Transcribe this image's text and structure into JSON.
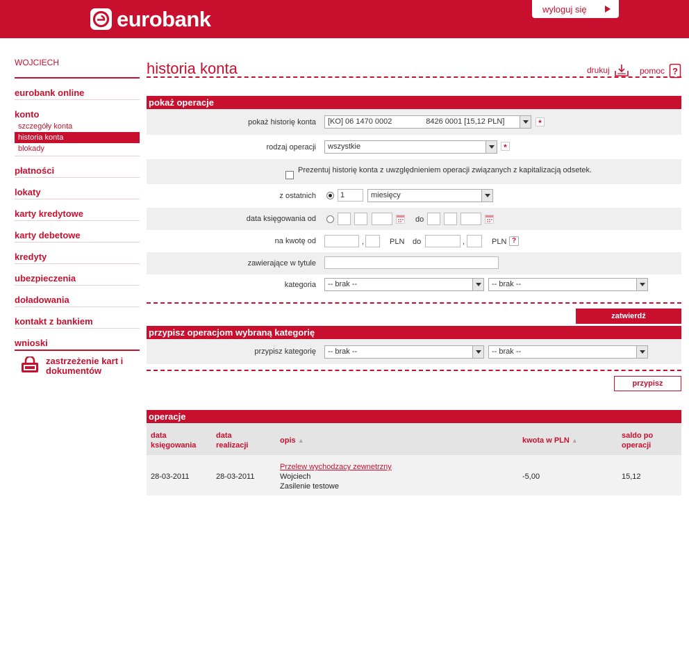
{
  "header": {
    "brand": "eurobank",
    "logout_label": "wyloguj się"
  },
  "sidebar": {
    "user": "WOJCIECH",
    "items": [
      {
        "label": "eurobank online"
      },
      {
        "label": "konto",
        "sub": [
          "szczegóły konta",
          "historia konta",
          "blokady"
        ],
        "active_sub": "historia konta"
      },
      {
        "label": "płatności"
      },
      {
        "label": "lokaty"
      },
      {
        "label": "karty kredytowe"
      },
      {
        "label": "karty debetowe"
      },
      {
        "label": "kredyty"
      },
      {
        "label": "ubezpieczenia"
      },
      {
        "label": "doładowania"
      },
      {
        "label": "kontakt z bankiem"
      },
      {
        "label": "wnioski"
      }
    ],
    "lock_line1": "zastrzeżenie kart i",
    "lock_line2": "dokumentów"
  },
  "page": {
    "title": "historia konta",
    "print_label": "drukuj",
    "help_label": "pomoc"
  },
  "filter": {
    "section_title": "pokaż operacje",
    "account_label": "pokaż historię konta",
    "account_value": "[KO] 06 1470 0002                8426 0001 [15,12 PLN]",
    "optype_label": "rodzaj operacji",
    "optype_value": "wszystkie",
    "capitalization_text": "Prezentuj historię konta z uwzględnieniem operacji związanych z kapitalizacją odsetek.",
    "last_label": "z ostatnich",
    "last_value": "1",
    "last_unit": "miesięcy",
    "date_label": "data księgowania od",
    "date_to": "do",
    "amount_label": "na kwotę od",
    "amount_sep": ",",
    "amount_currency": "PLN",
    "amount_to": "do",
    "title_label": "zawierające w tytule",
    "title_value": "",
    "category_label": "kategoria",
    "category_value": "-- brak --",
    "subcategory_value": "-- brak --",
    "submit_label": "zatwierdź"
  },
  "assign": {
    "section_title": "przypisz operacjom wybraną kategorię",
    "label": "przypisz kategorię",
    "category_value": "-- brak --",
    "subcategory_value": "-- brak --",
    "button_label": "przypisz"
  },
  "operations": {
    "section_title": "operacje",
    "columns": {
      "booking_1": "data",
      "booking_2": "księgowania",
      "exec_1": "data",
      "exec_2": "realizacji",
      "desc": "opis",
      "amount": "kwota w PLN",
      "balance_1": "saldo po",
      "balance_2": "operacji"
    },
    "rows": [
      {
        "booking_date": "28-03-2011",
        "exec_date": "28-03-2011",
        "desc_link": "Przelew wychodzacy zewnetrzny",
        "desc_line2": "Wojciech",
        "desc_line3": "Zasilenie testowe",
        "amount": "-5,00",
        "balance": "15,12"
      }
    ]
  },
  "colors": {
    "brand": "#c8102e"
  }
}
